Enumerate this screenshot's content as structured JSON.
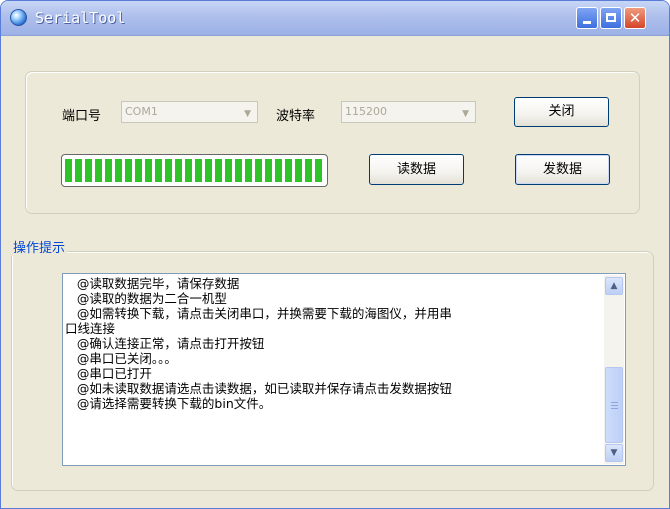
{
  "window": {
    "title": "SerialTool",
    "controls": [
      "minimize-icon",
      "maximize-icon",
      "close-icon"
    ]
  },
  "settings": {
    "port_label": "端口号",
    "port_value": "COM1",
    "baud_label": "波特率",
    "baud_value": "115200",
    "close_button": "关闭"
  },
  "progress": {
    "percent": 100,
    "color": "#2fc229"
  },
  "actions": {
    "read_button": "读数据",
    "send_button": "发数据"
  },
  "tips": {
    "group_title": "操作提示",
    "lines": [
      "   @读取数据完毕，请保存数据",
      "   @读取的数据为二合一机型",
      "   @如需转换下载，请点击关闭串口，并换需要下载的海图仪，并用串",
      "口线连接",
      "   @确认连接正常，请点击打开按钮",
      "   @串口已关闭。。。",
      "   @串口已打开",
      "   @如未读取数据请选点击读数据，如已读取并保存请点击发数据按钮",
      "   @请选择需要转换下载的bin文件。"
    ]
  },
  "colors": {
    "title_bar": "#9cb1e6",
    "window_bg": "#ece9d8",
    "group_title": "#0046d5"
  }
}
